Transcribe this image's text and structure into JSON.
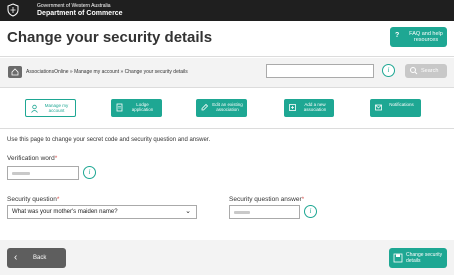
{
  "header": {
    "gov_line": "Government of Western Australia",
    "dept_line": "Department of Commerce"
  },
  "page": {
    "title": "Change your security details",
    "faq_icon": "question-mark-icon",
    "faq_label": "FAQ and help resources"
  },
  "breadcrumb": {
    "home_icon": "home-icon",
    "text": "AssociationsOnline » Manage my account » Change your security details"
  },
  "search": {
    "value": "",
    "placeholder": "",
    "info_icon": "info-icon",
    "button_label": "Search"
  },
  "nav": [
    {
      "label": "Manage my account",
      "icon": "user-icon",
      "active": true
    },
    {
      "label": "Lodge application",
      "icon": "document-icon",
      "active": false
    },
    {
      "label": "Edit an existing association",
      "icon": "edit-icon",
      "active": false
    },
    {
      "label": "Add a new association",
      "icon": "add-icon",
      "active": false
    },
    {
      "label": "Notifications",
      "icon": "notification-icon",
      "active": false
    }
  ],
  "form": {
    "intro": "Use this page to change your secret code and security question and answer.",
    "verification_label": "Verification word",
    "question_label": "Security question",
    "question_value": "What was your mother's maiden name?",
    "answer_label": "Security question answer",
    "required_mark": "*"
  },
  "footer": {
    "back_label": "Back",
    "change_label": "Change security details"
  },
  "colors": {
    "accent": "#1ea793",
    "header_bg": "#1f1f1f",
    "required": "#d9534f"
  }
}
